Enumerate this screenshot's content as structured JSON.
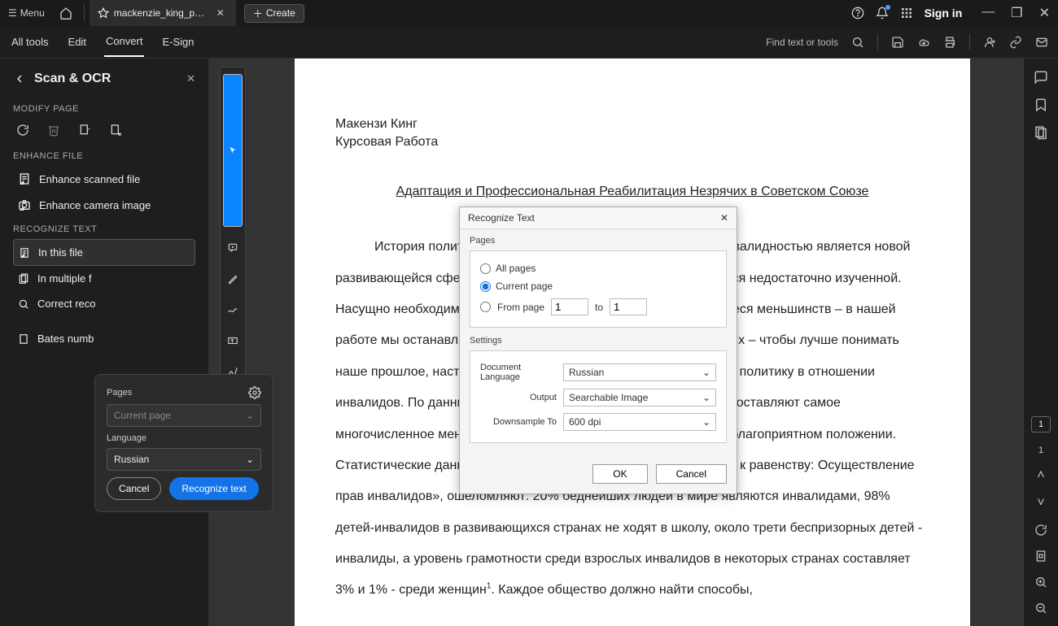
{
  "titlebar": {
    "menu": "Menu",
    "tab_title": "mackenzie_king_pdf pa...",
    "create": "Create",
    "sign_in": "Sign in"
  },
  "toolbar": {
    "all_tools": "All tools",
    "edit": "Edit",
    "convert": "Convert",
    "esign": "E-Sign",
    "search_label": "Find text or tools"
  },
  "sidepanel": {
    "title": "Scan & OCR",
    "sections": {
      "modify": "MODIFY PAGE",
      "enhance": "ENHANCE FILE",
      "recognize": "RECOGNIZE TEXT"
    },
    "items": {
      "enh_scan": "Enhance scanned file",
      "enh_cam": "Enhance camera image",
      "in_this": "In this file",
      "in_mult": "In multiple f",
      "correct": "Correct reco",
      "bates": "Bates numb"
    }
  },
  "popover": {
    "pages_label": "Pages",
    "pages_value": "Current page",
    "lang_label": "Language",
    "lang_value": "Russian",
    "cancel": "Cancel",
    "recognize": "Recognize text"
  },
  "modal": {
    "title": "Recognize Text",
    "pages": "Pages",
    "all_pages": "All pages",
    "current_page": "Current page",
    "from_page": "From page",
    "to": "to",
    "from_val": "1",
    "to_val": "1",
    "settings": "Settings",
    "doc_lang_label": "Document Language",
    "doc_lang_val": "Russian",
    "output_label": "Output",
    "output_val": "Searchable Image",
    "down_label": "Downsample To",
    "down_val": "600 dpi",
    "ok": "OK",
    "cancel": "Cancel"
  },
  "document": {
    "author": "Макензи Кинг",
    "subtitle": "Курсовая Работа",
    "title": "Адаптация и Профессиональная Реабилитация Незрячих в Советском Союзе",
    "body": "История политики Советского Союза в отношении лиц с инвалидностью  является новой развивающейся сферой в исследованиях России, которая остается недостаточно изученной. Насущно необходимо изучать проблемы инвалидности, касающиеся меньшинств – в нашей работе мы останавливаемся на исследовании положения незрячих – чтобы лучше понимать наше прошлое, настоящее и будущее, а именно государственную политику в отношении инвалидов. По данным ЮНЕСКО, в настоящее время инвалиды составляют самое многочисленное меньшинство в мире и находятся в наиболее неблагоприятном положении. Статистические данные в публикации «От социальной изоляции - к равенству: Осуществление прав инвалидов», ошеломляют: 20% беднейших людей в мире являются инвалидами, 98% детей-инвалидов в развивающихся странах не ходят в школу, около трети беспризорных детей - инвалиды, а уровень грамотности среди взрослых инвалидов в некоторых странах составляет 3% и 1% - среди женщин",
    "footnote_body": ". Каждое общество должно найти способы,"
  },
  "nav": {
    "current": "1",
    "total": "1"
  }
}
